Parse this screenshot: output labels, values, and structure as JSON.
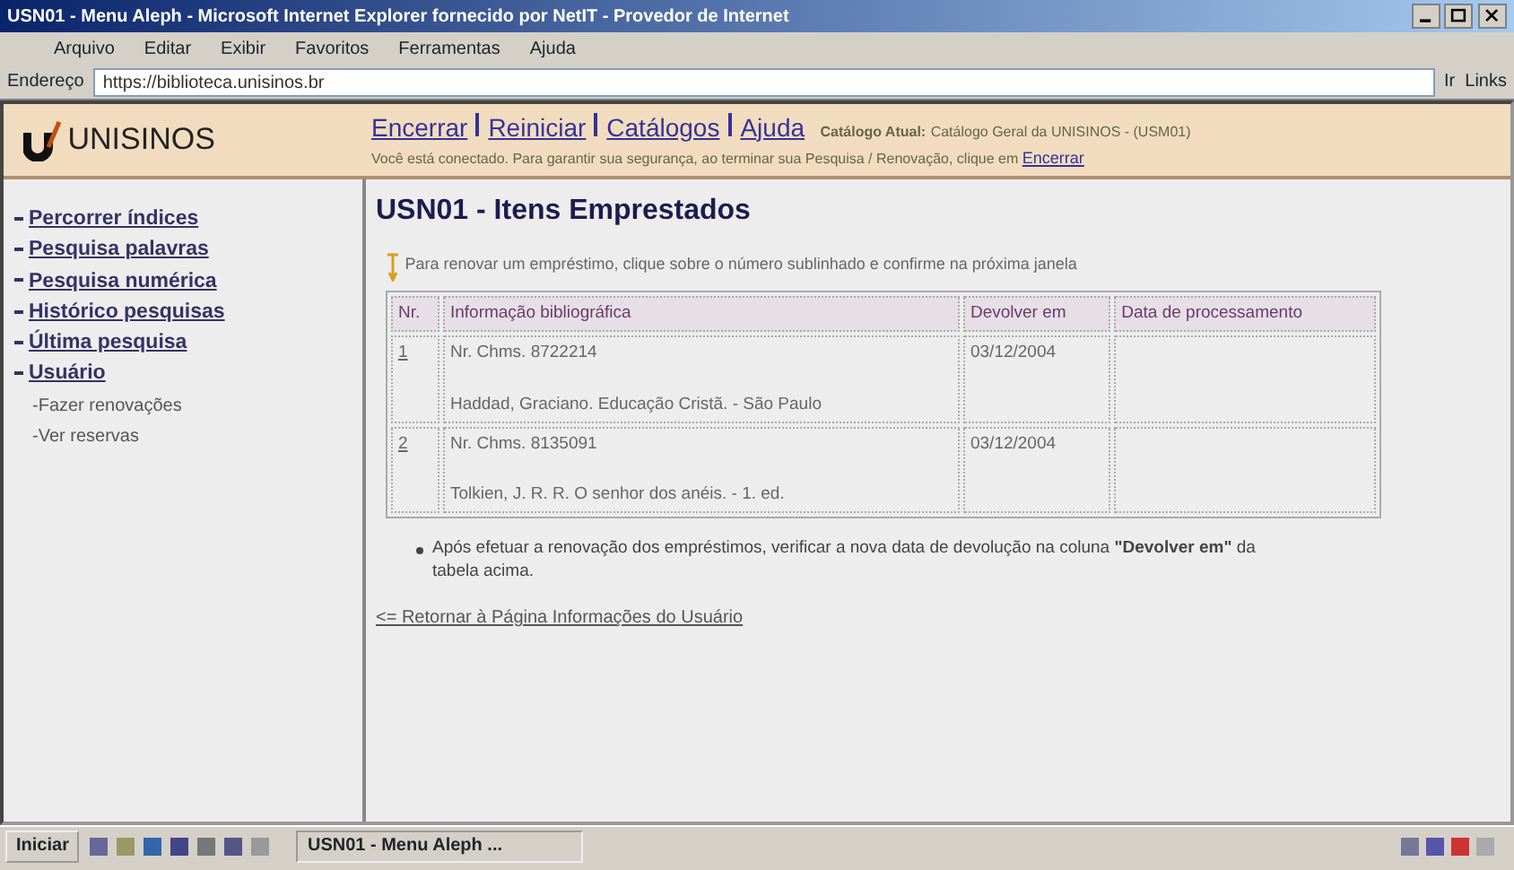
{
  "window": {
    "title": "USN01 - Menu Aleph - Microsoft Internet Explorer fornecido por NetIT - Provedor de Internet"
  },
  "menu": [
    "Arquivo",
    "Editar",
    "Exibir",
    "Favoritos",
    "Ferramentas",
    "Ajuda"
  ],
  "address": {
    "label": "Endereço",
    "value": "https://biblioteca.unisinos.br",
    "go": "Ir",
    "links": "Links"
  },
  "header": {
    "logo": "UNISINOS",
    "links": [
      "Encerrar",
      "Reiniciar",
      "Catálogos",
      "Ajuda"
    ],
    "catalog_label": "Catálogo Atual:",
    "catalog": "Catálogo Geral da UNISINOS - (USM01)",
    "notice": "Você está conectado. Para garantir sua segurança, ao terminar sua Pesquisa / Renovação, clique em",
    "notice_link": "Encerrar"
  },
  "sidebar": {
    "items": [
      {
        "label": "Percorrer índices"
      },
      {
        "label": "Pesquisa palavras"
      },
      {
        "label": "Pesquisa numérica"
      },
      {
        "label": "Histórico pesquisas"
      },
      {
        "label": "Última pesquisa"
      },
      {
        "label": "Usuário",
        "children": [
          {
            "label": "-Fazer renovações"
          },
          {
            "label": "-Ver reservas"
          }
        ]
      }
    ]
  },
  "content": {
    "title": "USN01 - Itens Emprestados",
    "hint": "Para renovar um empréstimo, clique sobre o número sublinhado e confirme na próxima janela",
    "table": {
      "columns": [
        "Nr.",
        "Informação bibliográfica",
        "Devolver em",
        "Data de processamento"
      ],
      "rows": [
        {
          "nr": "1",
          "call": "Nr. Chms. 8722214",
          "ref": "Haddad, Graciano. Educação Cristã. - São Paulo",
          "due": "03/12/2004"
        },
        {
          "nr": "2",
          "call": "Nr. Chms. 8135091",
          "ref": "Tolkien, J. R. R. O senhor dos anéis. - 1. ed.",
          "due": "03/12/2004"
        }
      ]
    },
    "note": "Após efetuar a renovação dos empréstimos, verificar a nova data de devolução na coluna **\"Devolver em\"** da tabela acima.",
    "back_link": "<= Retornar à Página Informações do Usuário"
  },
  "taskbar": {
    "start": "Iniciar",
    "task": "USN01 - Menu Aleph ..."
  }
}
